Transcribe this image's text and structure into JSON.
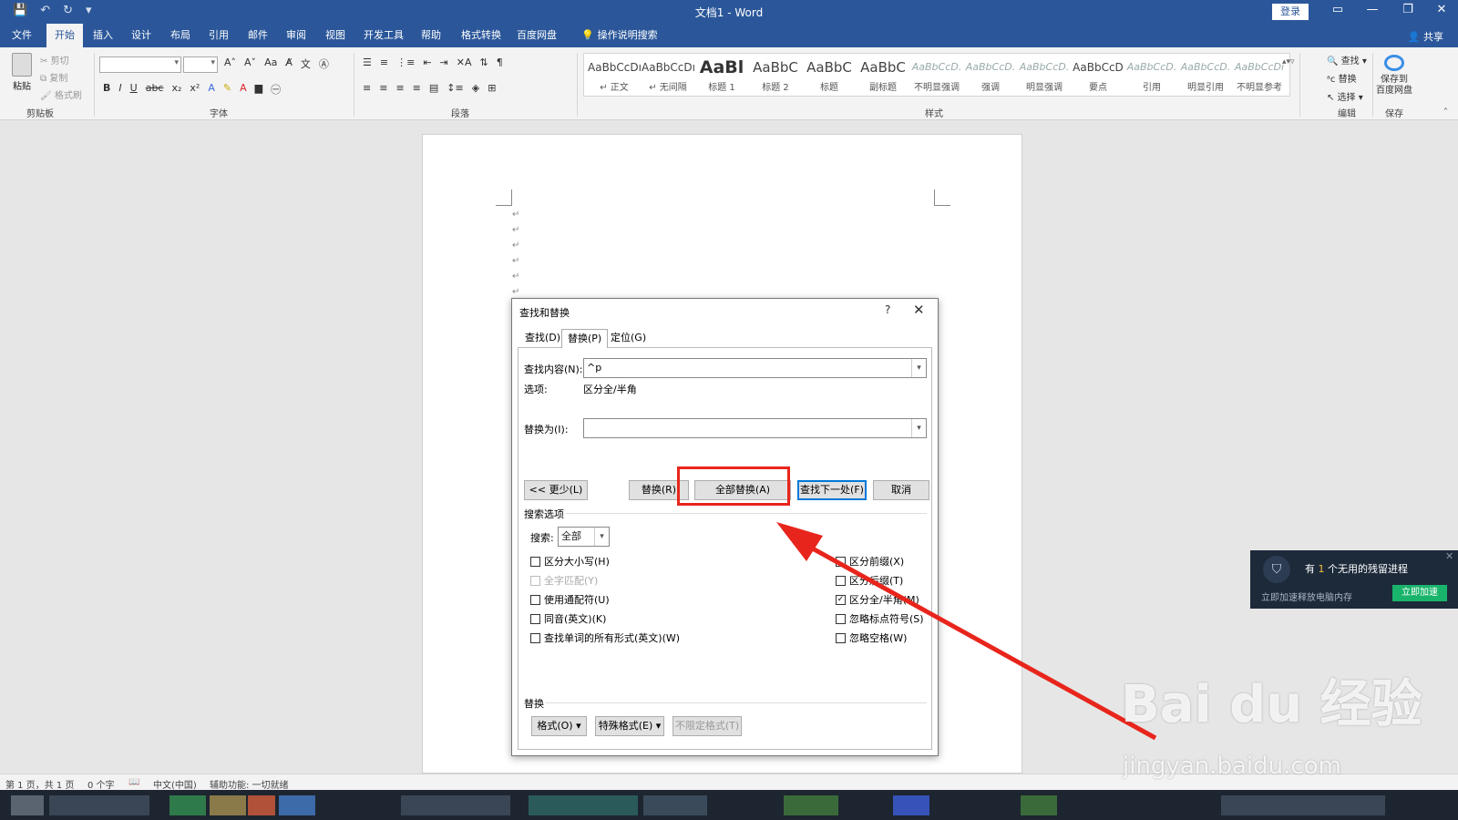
{
  "title_bar": {
    "doc_title": "文档1  -  Word",
    "login": "登录",
    "qat": [
      "💾",
      "↶",
      "↻",
      "▾"
    ],
    "win": [
      "▭",
      "—",
      "❐",
      "✕"
    ]
  },
  "tabs": [
    "文件",
    "开始",
    "插入",
    "设计",
    "布局",
    "引用",
    "邮件",
    "审阅",
    "视图",
    "开发工具",
    "帮助",
    "格式转换",
    "百度网盘",
    "操作说明搜索"
  ],
  "share": "共享",
  "ribbon": {
    "clipboard": {
      "paste": "粘贴",
      "cut": "剪切",
      "copy": "复制",
      "painter": "格式刷",
      "label": "剪贴板"
    },
    "font_label": "字体",
    "paragraph_label": "段落",
    "styles_label": "样式",
    "editing_label": "编辑",
    "save_label": "保存",
    "styles": [
      {
        "preview": "AaBbCcDı",
        "name": "↵ 正文",
        "kind": "normal"
      },
      {
        "preview": "AaBbCcDı",
        "name": "↵ 无间隔",
        "kind": "normal"
      },
      {
        "preview": "AaBl",
        "name": "标题 1",
        "kind": "big"
      },
      {
        "preview": "AaBbC",
        "name": "标题 2",
        "kind": "mid"
      },
      {
        "preview": "AaBbC",
        "name": "标题",
        "kind": "mid"
      },
      {
        "preview": "AaBbC",
        "name": "副标题",
        "kind": "mid"
      },
      {
        "preview": "AaBbCcD.",
        "name": "不明显强调",
        "kind": "muted"
      },
      {
        "preview": "AaBbCcD.",
        "name": "强调",
        "kind": "muted"
      },
      {
        "preview": "AaBbCcD.",
        "name": "明显强调",
        "kind": "muted"
      },
      {
        "preview": "AaBbCcD",
        "name": "要点",
        "kind": "normal"
      },
      {
        "preview": "AaBbCcD.",
        "name": "引用",
        "kind": "muted"
      },
      {
        "preview": "AaBbCcD.",
        "name": "明显引用",
        "kind": "muted"
      },
      {
        "preview": "AaBbCcDı",
        "name": "不明显参考",
        "kind": "muted"
      }
    ],
    "find": "查找",
    "replace": "替换",
    "select": "选择",
    "cloud_save": "保存到\n百度网盘"
  },
  "dialog": {
    "title": "查找和替换",
    "help": "?",
    "close": "✕",
    "tabs": [
      "查找(D)",
      "替换(P)",
      "定位(G)"
    ],
    "find_label": "查找内容(N):",
    "find_value": "^p",
    "options_label": "选项:",
    "options_value": "区分全/半角",
    "replace_label": "替换为(I):",
    "replace_value": "",
    "buttons": {
      "less": "<< 更少(L)",
      "replace": "替换(R)",
      "replace_all": "全部替换(A)",
      "find_next": "查找下一处(F)",
      "cancel": "取消"
    },
    "search_options_label": "搜索选项",
    "search_label": "搜索:",
    "search_value": "全部",
    "left_checks": [
      {
        "label": "区分大小写(H)",
        "checked": false,
        "disabled": false
      },
      {
        "label": "全字匹配(Y)",
        "checked": false,
        "disabled": true
      },
      {
        "label": "使用通配符(U)",
        "checked": false,
        "disabled": false
      },
      {
        "label": "同音(英文)(K)",
        "checked": false,
        "disabled": false
      },
      {
        "label": "查找单词的所有形式(英文)(W)",
        "checked": false,
        "disabled": false
      }
    ],
    "right_checks": [
      {
        "label": "区分前缀(X)",
        "checked": false
      },
      {
        "label": "区分后缀(T)",
        "checked": false
      },
      {
        "label": "区分全/半角(M)",
        "checked": true
      },
      {
        "label": "忽略标点符号(S)",
        "checked": false
      },
      {
        "label": "忽略空格(W)",
        "checked": false
      }
    ],
    "replace_section_label": "替换",
    "format_btn": "格式(O) ▾",
    "special_btn": "特殊格式(E) ▾",
    "noformat_btn": "不限定格式(T)"
  },
  "status": {
    "page": "第 1 页，共 1 页",
    "words": "0 个字",
    "lang": "中文(中国)",
    "a11y": "辅助功能: 一切就绪"
  },
  "notify": {
    "msg_prefix": "有 ",
    "msg_count": "1",
    "msg_suffix": " 个无用的残留进程",
    "sub": "立即加速释放电脑内存",
    "action": "立即加速",
    "close": "✕"
  },
  "watermark": {
    "main": "Bai du 经验",
    "url": "jingyan.baidu.com"
  },
  "colors": {
    "word_blue": "#2b579a",
    "highlight_red": "#e8251c",
    "accent_green": "#19b46b"
  }
}
